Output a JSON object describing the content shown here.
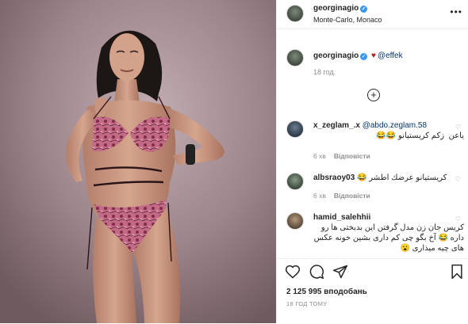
{
  "header": {
    "username": "georginagio",
    "location": "Monte-Carlo, Monaco",
    "more": "•••"
  },
  "caption": {
    "username": "georginagio",
    "heart": "♥",
    "mention": "@effek",
    "time": "18 год."
  },
  "load_more": "+",
  "comments": [
    {
      "username": "x_zeglam_.x",
      "mention": "@abdo.zeglam.58",
      "text": "ياعن  زكم كريستيانو 😂😂",
      "time": "6 хв",
      "reply": "Відповісти"
    },
    {
      "username": "albsraoy03",
      "text": "كريستيانو عرضك اطشر 😂",
      "time": "6 хв",
      "reply": "Відповісти"
    },
    {
      "username": "hamid_salehhii",
      "text": "کریس جان زن مدل گرفتن این بدبختی ها رو داره 😂 آخ بگو چی کم داری بشین خونه عکس های چیه میذاری 😮"
    }
  ],
  "actions": {
    "likes": "2 125 995 вподобань",
    "date": "18 ГОД ТОМУ"
  },
  "colors": {
    "link": "#003569",
    "verified": "#3897f0",
    "muted": "#8e8e8e",
    "heart": "#b71c1c",
    "photo_backdrop": "#9b8389",
    "swimsuit": "#c46a86"
  },
  "icons": [
    "more-icon",
    "verified-icon",
    "heart-icon",
    "comment-icon",
    "share-icon",
    "bookmark-icon",
    "add-circle-icon"
  ]
}
